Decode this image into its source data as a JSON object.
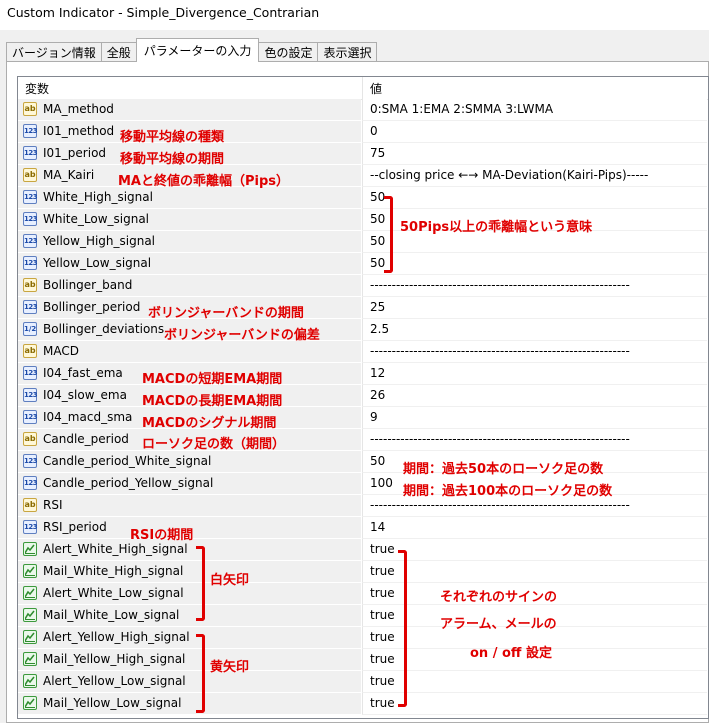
{
  "window": {
    "title": "Custom Indicator - Simple_Divergence_Contrarian"
  },
  "tabs": [
    {
      "label": "バージョン情報",
      "active": false
    },
    {
      "label": "全般",
      "active": false
    },
    {
      "label": "パラメーターの入力",
      "active": true
    },
    {
      "label": "色の設定",
      "active": false
    },
    {
      "label": "表示選択",
      "active": false
    }
  ],
  "grid": {
    "header_var": "変数",
    "header_val": "値",
    "rows": [
      {
        "type": "string",
        "name": "MA_method",
        "value": "0:SMA   1:EMA   2:SMMA   3:LWMA"
      },
      {
        "type": "int",
        "name": "I01_method",
        "value": "0"
      },
      {
        "type": "int",
        "name": "I01_period",
        "value": "75"
      },
      {
        "type": "string",
        "name": "MA_Kairi",
        "value": "--closing price    ←→    MA-Deviation(Kairi-Pips)-----"
      },
      {
        "type": "int",
        "name": "White_High_signal",
        "value": "50"
      },
      {
        "type": "int",
        "name": "White_Low_signal",
        "value": "50"
      },
      {
        "type": "int",
        "name": "Yellow_High_signal",
        "value": "50"
      },
      {
        "type": "int",
        "name": "Yellow_Low_signal",
        "value": "50"
      },
      {
        "type": "string",
        "name": "Bollinger_band",
        "value": "------------------------------------------------------------"
      },
      {
        "type": "int",
        "name": "Bollinger_period",
        "value": "25"
      },
      {
        "type": "double",
        "name": "Bollinger_deviations",
        "value": "2.5"
      },
      {
        "type": "string",
        "name": "MACD",
        "value": "------------------------------------------------------------"
      },
      {
        "type": "int",
        "name": "I04_fast_ema",
        "value": "12"
      },
      {
        "type": "int",
        "name": "I04_slow_ema",
        "value": "26"
      },
      {
        "type": "int",
        "name": "I04_macd_sma",
        "value": "9"
      },
      {
        "type": "string",
        "name": "Candle_period",
        "value": "------------------------------------------------------------"
      },
      {
        "type": "int",
        "name": "Candle_period_White_signal",
        "value": "50"
      },
      {
        "type": "int",
        "name": "Candle_period_Yellow_signal",
        "value": "100"
      },
      {
        "type": "string",
        "name": "RSI",
        "value": "------------------------------------------------------------"
      },
      {
        "type": "int",
        "name": "RSI_period",
        "value": "14"
      },
      {
        "type": "bool",
        "name": "Alert_White_High_signal",
        "value": "true"
      },
      {
        "type": "bool",
        "name": "Mail_White_High_signal",
        "value": "true"
      },
      {
        "type": "bool",
        "name": "Alert_White_Low_signal",
        "value": "true"
      },
      {
        "type": "bool",
        "name": "Mail_White_Low_signal",
        "value": "true"
      },
      {
        "type": "bool",
        "name": "Alert_Yellow_High_signal",
        "value": "true"
      },
      {
        "type": "bool",
        "name": "Mail_Yellow_High_signal",
        "value": "true"
      },
      {
        "type": "bool",
        "name": "Alert_Yellow_Low_signal",
        "value": "true"
      },
      {
        "type": "bool",
        "name": "Mail_Yellow_Low_signal",
        "value": "true"
      }
    ]
  },
  "annotations": {
    "ma_method": "移動平均線の種類",
    "ma_period": "移動平均線の期間",
    "kairi": "MAと終値の乖離幅（Pips）",
    "kairi_range": "50Pips以上の乖離幅という意味",
    "bb_period": "ボリンジャーバンドの期間",
    "bb_dev": "ボリンジャーバンドの偏差",
    "macd_fast": "MACDの短期EMA期間",
    "macd_slow": "MACDの長期EMA期間",
    "macd_signal": "MACDのシグナル期間",
    "candle": "ローソク足の数（期間）",
    "candle_white": "期間：過去50本のローソク足の数",
    "candle_yellow": "期間：過去100本のローソク足の数",
    "rsi": "RSIの期間",
    "white_arrow": "白矢印",
    "yellow_arrow": "黄矢印",
    "notify_line1": "それぞれのサインの",
    "notify_line2": "アラーム、メールの",
    "notify_line3": "on / off 設定"
  }
}
